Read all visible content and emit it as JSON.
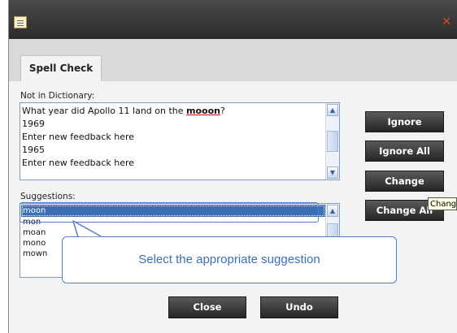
{
  "window": {
    "icon": "document-icon",
    "close_icon": "close-x-icon"
  },
  "tabs": [
    {
      "label": "Spell Check"
    }
  ],
  "not_in_dictionary": {
    "label": "Not in Dictionary:",
    "lines": [
      {
        "prefix": "What year did Apollo 11 land on the ",
        "misspelled": "mooon",
        "suffix": "?"
      },
      {
        "text": "1969"
      },
      {
        "text": "Enter new feedback here"
      },
      {
        "text": "1965"
      },
      {
        "text": "Enter new feedback here"
      }
    ]
  },
  "suggestions": {
    "label": "Suggestions:",
    "items": [
      "moon",
      "mon",
      "moan",
      "mono",
      "mown"
    ],
    "selected": "moon"
  },
  "buttons": {
    "ignore": "Ignore",
    "ignore_all": "Ignore All",
    "change": "Change",
    "change_all": "Change All",
    "close": "Close",
    "undo": "Undo"
  },
  "tooltip": "Change",
  "callout": "Select the appropriate suggestion",
  "colors": {
    "titlebar": "#2b2b2b",
    "selection": "#3d6fb5",
    "callout_border": "#4f7ec9",
    "button": "#333333"
  }
}
